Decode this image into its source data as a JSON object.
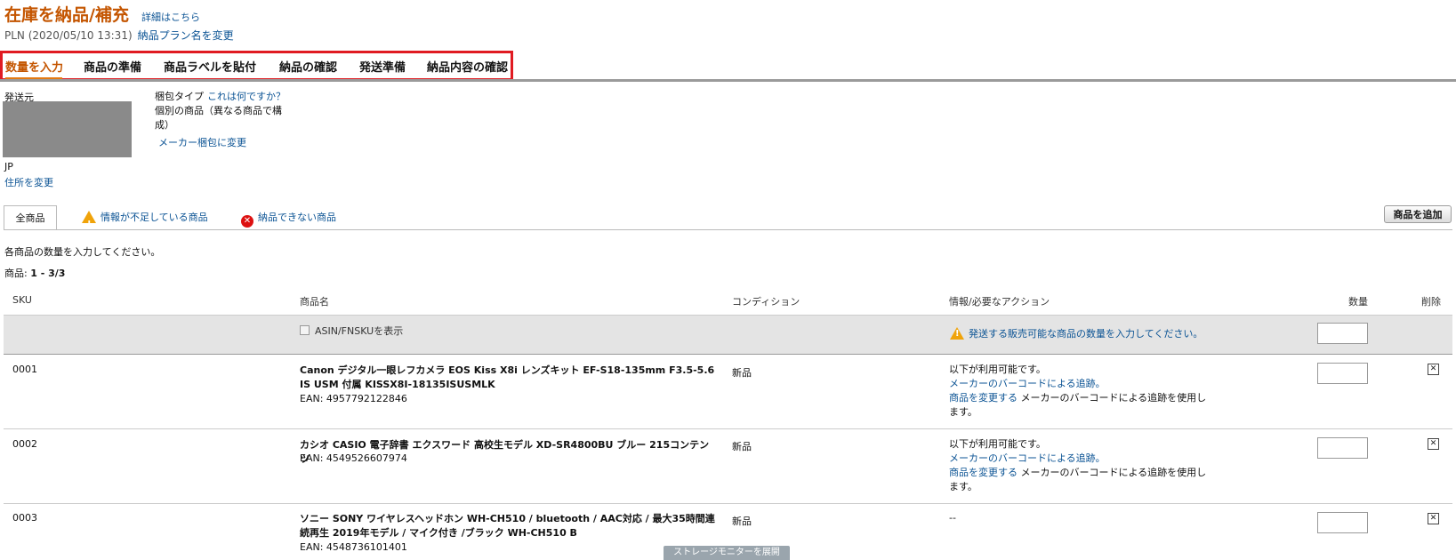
{
  "header": {
    "title": "在庫を納品/補充",
    "details_link": "詳細はこちら",
    "plan_name": "PLN (2020/05/10 13:31)",
    "rename_link": "納品プラン名を変更"
  },
  "steps": [
    "数量を入力",
    "商品の準備",
    "商品ラベルを貼付",
    "納品の確認",
    "発送準備",
    "納品内容の確認"
  ],
  "ship_from": {
    "label": "発送元",
    "country": "JP",
    "change_address": "住所を変更"
  },
  "packing": {
    "label": "梱包タイプ",
    "help_link": "これは何ですか？",
    "value": "個別の商品（異なる商品で構成）",
    "change_link": "メーカー梱包に変更"
  },
  "tabs": {
    "all": "全商品",
    "missing_info": "情報が不足している商品",
    "cannot_ship": "納品できない商品"
  },
  "add_product_button": "商品を追加",
  "instruction": "各商品の数量を入力してください。",
  "count": {
    "label": "商品:",
    "range": "1 - 3/3"
  },
  "columns": {
    "sku": "SKU",
    "name": "商品名",
    "condition": "コンディション",
    "info": "情報/必要なアクション",
    "quantity": "数量",
    "delete": "削除"
  },
  "filter_row": {
    "checkbox_label": "ASIN/FNSKUを表示",
    "warning": "発送する販売可能な商品の数量を入力してください。"
  },
  "products": [
    {
      "sku": "0001",
      "title": "Canon デジタル一眼レフカメラ EOS Kiss X8i レンズキット EF-S18-135mm F3.5-5.6 IS USM 付属 KISSX8I-18135ISUSMLK",
      "ean": "EAN: 4957792122846",
      "condition": "新品",
      "info_line1": "以下が利用可能です。",
      "info_link1": "メーカーのバーコードによる追跡。",
      "info_link2": "商品を変更する",
      "info_tail": "メーカーのバーコードによる追跡を使用します。"
    },
    {
      "sku": "0002",
      "title": "カシオ CASIO 電子辞書 エクスワード 高校生モデル XD-SR4800BU ブルー 215コンテンツ",
      "ean": "EAN: 4549526607974",
      "condition": "新品",
      "info_line1": "以下が利用可能です。",
      "info_link1": "メーカーのバーコードによる追跡。",
      "info_link2": "商品を変更する",
      "info_tail": "メーカーのバーコードによる追跡を使用します。"
    },
    {
      "sku": "0003",
      "title": "ソニー SONY ワイヤレスヘッドホン WH-CH510 / bluetooth / AAC対応 / 最大35時間連続再生 2019年モデル / マイク付き /ブラック WH-CH510 B",
      "ean": "EAN: 4548736101401",
      "condition": "新品",
      "info_line1": "--"
    }
  ],
  "storage_monitor": "ストレージモニターを展開",
  "colors": {
    "title_orange": "#c45500",
    "link_blue": "#0b5394",
    "highlight_red": "#e01b22",
    "accent_orange": "#e47911"
  }
}
